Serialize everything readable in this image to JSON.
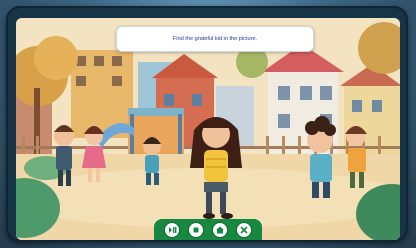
{
  "game": {
    "instruction": "Find the grateful kid in the picture."
  },
  "controls": [
    {
      "icon": "play-pause-icon"
    },
    {
      "icon": "stop-icon"
    },
    {
      "icon": "home-icon"
    },
    {
      "icon": "close-icon"
    }
  ],
  "colors": {
    "control_bar": "#17883f",
    "prompt_text": "#1d3c9a",
    "frame": "#173446"
  }
}
